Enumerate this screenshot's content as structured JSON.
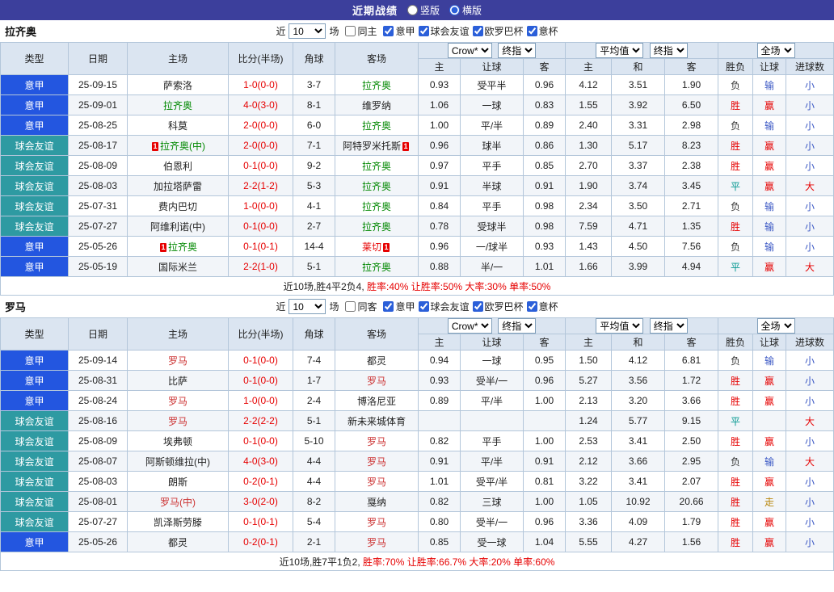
{
  "header": {
    "title": "近期战绩",
    "layout_options": [
      {
        "label": "竖版",
        "selected": false
      },
      {
        "label": "横版",
        "selected": true
      }
    ]
  },
  "filter_labels": {
    "near": "近",
    "matches": "场",
    "leagues": [
      "意甲",
      "球会友谊",
      "欧罗巴杯",
      "意杯"
    ]
  },
  "columns": [
    "类型",
    "日期",
    "主场",
    "比分(半场)",
    "角球",
    "客场",
    "主",
    "让球",
    "客",
    "主",
    "和",
    "客",
    "胜负",
    "让球",
    "进球数"
  ],
  "head_selects": {
    "crow": "Crow*",
    "final": "终指",
    "avg": "平均值",
    "full": "全场"
  },
  "colors": {
    "type": {
      "意甲": "#2356e0",
      "球会友谊": "#2e9aa2"
    },
    "result": {
      "胜": "#e60000",
      "平": "#00968f",
      "负": "#333333"
    },
    "handicap": {
      "赢": "#e60000",
      "输": "#3a57c4",
      "走": "#b8860b"
    },
    "goal": {
      "大": "#e60000",
      "小": "#3a57c4"
    },
    "score": "#e60000",
    "special_red": "#e60000"
  },
  "sections": [
    {
      "team": "拉齐奥",
      "team_color": "#008800",
      "filter": {
        "count": "10",
        "same_label": "同主",
        "same_checked": false,
        "leagues_checked": [
          true,
          true,
          true,
          true
        ]
      },
      "rows": [
        {
          "type": "意甲",
          "date": "25-09-15",
          "home": "萨索洛",
          "score": "1-0(0-0)",
          "corner": "3-7",
          "away": "拉齐奥",
          "away_is_team": true,
          "let_home": "0.93",
          "let_line": "受平半",
          "let_away": "0.96",
          "euro_home": "4.12",
          "euro_draw": "3.51",
          "euro_away": "1.90",
          "result": "负",
          "handicap": "输",
          "goal": "小"
        },
        {
          "type": "意甲",
          "date": "25-09-01",
          "home": "拉齐奥",
          "home_is_team": true,
          "score": "4-0(3-0)",
          "corner": "8-1",
          "away": "维罗纳",
          "let_home": "1.06",
          "let_line": "一球",
          "let_away": "0.83",
          "euro_home": "1.55",
          "euro_draw": "3.92",
          "euro_away": "6.50",
          "result": "胜",
          "handicap": "赢",
          "goal": "小"
        },
        {
          "type": "意甲",
          "date": "25-08-25",
          "home": "科莫",
          "score": "2-0(0-0)",
          "corner": "6-0",
          "away": "拉齐奥",
          "away_is_team": true,
          "let_home": "1.00",
          "let_line": "平/半",
          "let_away": "0.89",
          "euro_home": "2.40",
          "euro_draw": "3.31",
          "euro_away": "2.98",
          "result": "负",
          "handicap": "输",
          "goal": "小"
        },
        {
          "type": "球会友谊",
          "date": "25-08-17",
          "home": "拉齐奥(中)",
          "home_is_team": true,
          "home_card": true,
          "score": "2-0(0-0)",
          "corner": "7-1",
          "away": "阿特罗米托斯",
          "away_card": true,
          "let_home": "0.96",
          "let_line": "球半",
          "let_away": "0.86",
          "euro_home": "1.30",
          "euro_draw": "5.17",
          "euro_away": "8.23",
          "result": "胜",
          "handicap": "赢",
          "goal": "小"
        },
        {
          "type": "球会友谊",
          "date": "25-08-09",
          "home": "伯恩利",
          "score": "0-1(0-0)",
          "corner": "9-2",
          "away": "拉齐奥",
          "away_is_team": true,
          "let_home": "0.97",
          "let_line": "平手",
          "let_away": "0.85",
          "euro_home": "2.70",
          "euro_draw": "3.37",
          "euro_away": "2.38",
          "result": "胜",
          "handicap": "赢",
          "goal": "小"
        },
        {
          "type": "球会友谊",
          "date": "25-08-03",
          "home": "加拉塔萨雷",
          "score": "2-2(1-2)",
          "corner": "5-3",
          "away": "拉齐奥",
          "away_is_team": true,
          "let_home": "0.91",
          "let_line": "半球",
          "let_away": "0.91",
          "euro_home": "1.90",
          "euro_draw": "3.74",
          "euro_away": "3.45",
          "result": "平",
          "handicap": "赢",
          "goal": "大"
        },
        {
          "type": "球会友谊",
          "date": "25-07-31",
          "home": "费内巴切",
          "score": "1-0(0-0)",
          "corner": "4-1",
          "away": "拉齐奥",
          "away_is_team": true,
          "let_home": "0.84",
          "let_line": "平手",
          "let_away": "0.98",
          "euro_home": "2.34",
          "euro_draw": "3.50",
          "euro_away": "2.71",
          "result": "负",
          "handicap": "输",
          "goal": "小"
        },
        {
          "type": "球会友谊",
          "date": "25-07-27",
          "home": "阿维利诺(中)",
          "score": "0-1(0-0)",
          "corner": "2-7",
          "away": "拉齐奥",
          "away_is_team": true,
          "let_home": "0.78",
          "let_line": "受球半",
          "let_away": "0.98",
          "euro_home": "7.59",
          "euro_draw": "4.71",
          "euro_away": "1.35",
          "result": "胜",
          "handicap": "输",
          "goal": "小"
        },
        {
          "type": "意甲",
          "date": "25-05-26",
          "home": "拉齐奥",
          "home_is_team": true,
          "home_card": true,
          "score": "0-1(0-1)",
          "corner": "14-4",
          "away": "莱切",
          "away_red": true,
          "away_card": true,
          "let_home": "0.96",
          "let_line": "一/球半",
          "let_away": "0.93",
          "euro_home": "1.43",
          "euro_draw": "4.50",
          "euro_away": "7.56",
          "result": "负",
          "handicap": "输",
          "goal": "小"
        },
        {
          "type": "意甲",
          "date": "25-05-19",
          "home": "国际米兰",
          "score": "2-2(1-0)",
          "corner": "5-1",
          "away": "拉齐奥",
          "away_is_team": true,
          "let_home": "0.88",
          "let_line": "半/一",
          "let_away": "1.01",
          "euro_home": "1.66",
          "euro_draw": "3.99",
          "euro_away": "4.94",
          "result": "平",
          "handicap": "赢",
          "goal": "大"
        }
      ],
      "summary": {
        "prefix": "近10场,胜4平2负4,",
        "stats": "胜率:40% 让胜率:50% 大率:30% 单率:50%"
      }
    },
    {
      "team": "罗马",
      "team_color": "#cc3333",
      "filter": {
        "count": "10",
        "same_label": "同客",
        "same_checked": false,
        "leagues_checked": [
          true,
          true,
          true,
          true
        ]
      },
      "rows": [
        {
          "type": "意甲",
          "date": "25-09-14",
          "home": "罗马",
          "home_is_team": true,
          "score": "0-1(0-0)",
          "corner": "7-4",
          "away": "都灵",
          "let_home": "0.94",
          "let_line": "一球",
          "let_away": "0.95",
          "euro_home": "1.50",
          "euro_draw": "4.12",
          "euro_away": "6.81",
          "result": "负",
          "handicap": "输",
          "goal": "小"
        },
        {
          "type": "意甲",
          "date": "25-08-31",
          "home": "比萨",
          "score": "0-1(0-0)",
          "corner": "1-7",
          "away": "罗马",
          "away_is_team": true,
          "let_home": "0.93",
          "let_line": "受半/一",
          "let_away": "0.96",
          "euro_home": "5.27",
          "euro_draw": "3.56",
          "euro_away": "1.72",
          "result": "胜",
          "handicap": "赢",
          "goal": "小"
        },
        {
          "type": "意甲",
          "date": "25-08-24",
          "home": "罗马",
          "home_is_team": true,
          "score": "1-0(0-0)",
          "corner": "2-4",
          "away": "博洛尼亚",
          "let_home": "0.89",
          "let_line": "平/半",
          "let_away": "1.00",
          "euro_home": "2.13",
          "euro_draw": "3.20",
          "euro_away": "3.66",
          "result": "胜",
          "handicap": "赢",
          "goal": "小"
        },
        {
          "type": "球会友谊",
          "date": "25-08-16",
          "home": "罗马",
          "home_is_team": true,
          "score": "2-2(2-2)",
          "corner": "5-1",
          "away": "新未来城体育",
          "let_home": "",
          "let_line": "",
          "let_away": "",
          "euro_home": "1.24",
          "euro_draw": "5.77",
          "euro_away": "9.15",
          "result": "平",
          "handicap": "",
          "goal": "大"
        },
        {
          "type": "球会友谊",
          "date": "25-08-09",
          "home": "埃弗顿",
          "score": "0-1(0-0)",
          "corner": "5-10",
          "away": "罗马",
          "away_is_team": true,
          "let_home": "0.82",
          "let_line": "平手",
          "let_away": "1.00",
          "euro_home": "2.53",
          "euro_draw": "3.41",
          "euro_away": "2.50",
          "result": "胜",
          "handicap": "赢",
          "goal": "小"
        },
        {
          "type": "球会友谊",
          "date": "25-08-07",
          "home": "阿斯顿维拉(中)",
          "score": "4-0(3-0)",
          "corner": "4-4",
          "away": "罗马",
          "away_is_team": true,
          "let_home": "0.91",
          "let_line": "平/半",
          "let_away": "0.91",
          "euro_home": "2.12",
          "euro_draw": "3.66",
          "euro_away": "2.95",
          "result": "负",
          "handicap": "输",
          "goal": "大"
        },
        {
          "type": "球会友谊",
          "date": "25-08-03",
          "home": "朗斯",
          "score": "0-2(0-1)",
          "corner": "4-4",
          "away": "罗马",
          "away_is_team": true,
          "let_home": "1.01",
          "let_line": "受平/半",
          "let_away": "0.81",
          "euro_home": "3.22",
          "euro_draw": "3.41",
          "euro_away": "2.07",
          "result": "胜",
          "handicap": "赢",
          "goal": "小"
        },
        {
          "type": "球会友谊",
          "date": "25-08-01",
          "home": "罗马(中)",
          "home_is_team": true,
          "score": "3-0(2-0)",
          "corner": "8-2",
          "away": "戛纳",
          "let_home": "0.82",
          "let_line": "三球",
          "let_away": "1.00",
          "euro_home": "1.05",
          "euro_draw": "10.92",
          "euro_away": "20.66",
          "result": "胜",
          "handicap": "走",
          "goal": "小"
        },
        {
          "type": "球会友谊",
          "date": "25-07-27",
          "home": "凯泽斯劳滕",
          "score": "0-1(0-1)",
          "corner": "5-4",
          "away": "罗马",
          "away_is_team": true,
          "let_home": "0.80",
          "let_line": "受半/一",
          "let_away": "0.96",
          "euro_home": "3.36",
          "euro_draw": "4.09",
          "euro_away": "1.79",
          "result": "胜",
          "handicap": "赢",
          "goal": "小"
        },
        {
          "type": "意甲",
          "date": "25-05-26",
          "home": "都灵",
          "score": "0-2(0-1)",
          "corner": "2-1",
          "away": "罗马",
          "away_is_team": true,
          "let_home": "0.85",
          "let_line": "受一球",
          "let_away": "1.04",
          "euro_home": "5.55",
          "euro_draw": "4.27",
          "euro_away": "1.56",
          "result": "胜",
          "handicap": "赢",
          "goal": "小"
        }
      ],
      "summary": {
        "prefix": "近10场,胜7平1负2,",
        "stats": "胜率:70% 让胜率:66.7% 大率:20% 单率:60%"
      }
    }
  ]
}
